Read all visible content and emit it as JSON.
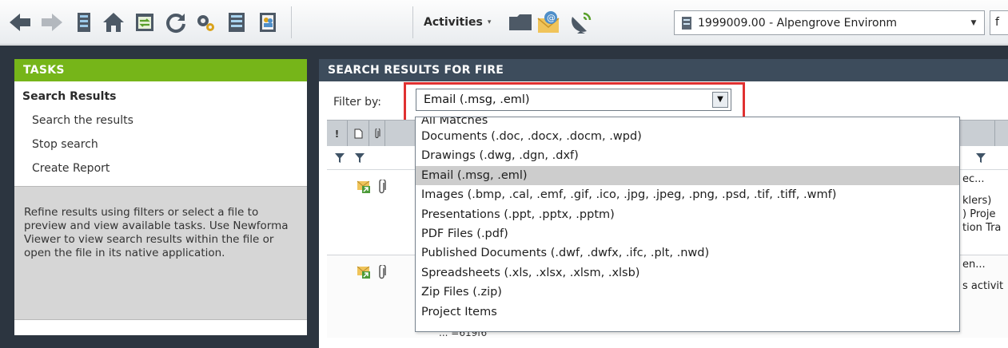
{
  "toolbar": {
    "icons": [
      "back-arrow-icon",
      "forward-arrow-icon",
      "server-icon",
      "home-icon",
      "transfer-icon",
      "refresh-icon",
      "settings-gear-icon",
      "document-list-icon",
      "contacts-icon",
      "folder-icon",
      "email-icon",
      "satellite-icon"
    ],
    "activities_label": "Activities",
    "project_value": "1999009.00 - Alpengrove Environm",
    "next_field_value": "f"
  },
  "tasks": {
    "header": "TASKS",
    "subheader": "Search Results",
    "links": [
      "Search the results",
      "Stop search",
      "Create Report"
    ],
    "info": "Refine results using filters or select a file to preview and view available tasks.  Use Newforma Viewer to view search results within the file or open the file in its native application."
  },
  "results": {
    "header": "SEARCH RESULTS FOR FIRE",
    "filter_label": "Filter by:",
    "filter_value": "Email (.msg, .eml)",
    "column_headers": [
      "!",
      "",
      ""
    ],
    "rows": [
      {
        "lines": [
          "ec...",
          "klers)",
          ") Proje",
          "tion Tra"
        ]
      },
      {
        "lines": [
          "en...",
          "s activit"
        ]
      }
    ],
    "bottom_text": "           ...                  =619f6"
  },
  "filter_options": [
    {
      "label": "All Matches",
      "selected": false
    },
    {
      "label": "Documents (.doc, .docx, .docm, .wpd)",
      "selected": false
    },
    {
      "label": "Drawings (.dwg, .dgn, .dxf)",
      "selected": false
    },
    {
      "label": "Email (.msg, .eml)",
      "selected": true
    },
    {
      "label": "Images (.bmp, .cal, .emf, .gif, .ico, .jpg, .jpeg, .png, .psd, .tif, .tiff, .wmf)",
      "selected": false
    },
    {
      "label": "Presentations (.ppt, .pptx, .pptm)",
      "selected": false
    },
    {
      "label": "PDF Files (.pdf)",
      "selected": false
    },
    {
      "label": "Published Documents (.dwf, .dwfx, .ifc, .plt, .nwd)",
      "selected": false
    },
    {
      "label": "Spreadsheets (.xls, .xlsx, .xlsm, .xlsb)",
      "selected": false
    },
    {
      "label": "Zip Files (.zip)",
      "selected": false
    },
    {
      "label": "Project Items",
      "selected": false
    }
  ],
  "colors": {
    "tasks_header": "#76b519",
    "results_header": "#3d4c5c",
    "highlight_border": "#e03131",
    "background_band": "#2c3540"
  }
}
